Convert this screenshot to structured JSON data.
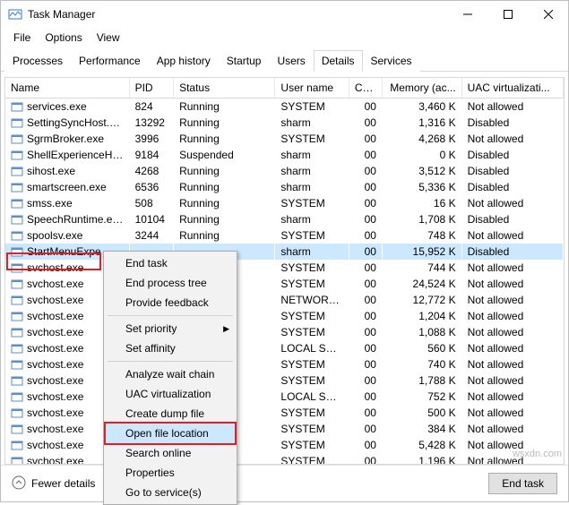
{
  "window": {
    "title": "Task Manager",
    "controls": {
      "min": "minimize",
      "max": "maximize",
      "close": "close"
    }
  },
  "menu": {
    "file": "File",
    "options": "Options",
    "view": "View"
  },
  "tabs": [
    {
      "label": "Processes"
    },
    {
      "label": "Performance"
    },
    {
      "label": "App history"
    },
    {
      "label": "Startup"
    },
    {
      "label": "Users"
    },
    {
      "label": "Details",
      "active": true
    },
    {
      "label": "Services"
    }
  ],
  "columns": {
    "name": "Name",
    "pid": "PID",
    "status": "Status",
    "user": "User name",
    "cpu": "CPU",
    "memory": "Memory (ac...",
    "uac": "UAC virtualizati..."
  },
  "rows": [
    {
      "name": "services.exe",
      "pid": "824",
      "status": "Running",
      "user": "SYSTEM",
      "cpu": "00",
      "mem": "3,460 K",
      "uac": "Not allowed"
    },
    {
      "name": "SettingSyncHost.exe",
      "pid": "13292",
      "status": "Running",
      "user": "sharm",
      "cpu": "00",
      "mem": "1,316 K",
      "uac": "Disabled"
    },
    {
      "name": "SgrmBroker.exe",
      "pid": "3996",
      "status": "Running",
      "user": "SYSTEM",
      "cpu": "00",
      "mem": "4,268 K",
      "uac": "Not allowed"
    },
    {
      "name": "ShellExperienceHost....",
      "pid": "9184",
      "status": "Suspended",
      "user": "sharm",
      "cpu": "00",
      "mem": "0 K",
      "uac": "Disabled"
    },
    {
      "name": "sihost.exe",
      "pid": "4268",
      "status": "Running",
      "user": "sharm",
      "cpu": "00",
      "mem": "3,512 K",
      "uac": "Disabled"
    },
    {
      "name": "smartscreen.exe",
      "pid": "6536",
      "status": "Running",
      "user": "sharm",
      "cpu": "00",
      "mem": "5,336 K",
      "uac": "Disabled"
    },
    {
      "name": "smss.exe",
      "pid": "508",
      "status": "Running",
      "user": "SYSTEM",
      "cpu": "00",
      "mem": "16 K",
      "uac": "Not allowed"
    },
    {
      "name": "SpeechRuntime.exe",
      "pid": "10104",
      "status": "Running",
      "user": "sharm",
      "cpu": "00",
      "mem": "1,708 K",
      "uac": "Disabled"
    },
    {
      "name": "spoolsv.exe",
      "pid": "3244",
      "status": "Running",
      "user": "SYSTEM",
      "cpu": "00",
      "mem": "748 K",
      "uac": "Not allowed"
    },
    {
      "name": "StartMenuExpe",
      "pid": "",
      "status": "",
      "user": "sharm",
      "cpu": "00",
      "mem": "15,952 K",
      "uac": "Disabled",
      "selected": true
    },
    {
      "name": "svchost.exe",
      "pid": "",
      "status": "",
      "user": "SYSTEM",
      "cpu": "00",
      "mem": "744 K",
      "uac": "Not allowed"
    },
    {
      "name": "svchost.exe",
      "pid": "",
      "status": "",
      "user": "SYSTEM",
      "cpu": "00",
      "mem": "24,524 K",
      "uac": "Not allowed"
    },
    {
      "name": "svchost.exe",
      "pid": "",
      "status": "",
      "user": "NETWORK ...",
      "cpu": "00",
      "mem": "12,772 K",
      "uac": "Not allowed"
    },
    {
      "name": "svchost.exe",
      "pid": "",
      "status": "",
      "user": "SYSTEM",
      "cpu": "00",
      "mem": "1,204 K",
      "uac": "Not allowed"
    },
    {
      "name": "svchost.exe",
      "pid": "",
      "status": "",
      "user": "SYSTEM",
      "cpu": "00",
      "mem": "1,088 K",
      "uac": "Not allowed"
    },
    {
      "name": "svchost.exe",
      "pid": "",
      "status": "",
      "user": "LOCAL SER...",
      "cpu": "00",
      "mem": "560 K",
      "uac": "Not allowed"
    },
    {
      "name": "svchost.exe",
      "pid": "",
      "status": "",
      "user": "SYSTEM",
      "cpu": "00",
      "mem": "740 K",
      "uac": "Not allowed"
    },
    {
      "name": "svchost.exe",
      "pid": "",
      "status": "",
      "user": "SYSTEM",
      "cpu": "00",
      "mem": "1,788 K",
      "uac": "Not allowed"
    },
    {
      "name": "svchost.exe",
      "pid": "",
      "status": "",
      "user": "LOCAL SER...",
      "cpu": "00",
      "mem": "752 K",
      "uac": "Not allowed"
    },
    {
      "name": "svchost.exe",
      "pid": "",
      "status": "",
      "user": "SYSTEM",
      "cpu": "00",
      "mem": "500 K",
      "uac": "Not allowed"
    },
    {
      "name": "svchost.exe",
      "pid": "",
      "status": "",
      "user": "SYSTEM",
      "cpu": "00",
      "mem": "384 K",
      "uac": "Not allowed"
    },
    {
      "name": "svchost.exe",
      "pid": "",
      "status": "",
      "user": "SYSTEM",
      "cpu": "00",
      "mem": "5,428 K",
      "uac": "Not allowed"
    },
    {
      "name": "svchost.exe",
      "pid": "",
      "status": "",
      "user": "SYSTEM",
      "cpu": "00",
      "mem": "1,196 K",
      "uac": "Not allowed"
    }
  ],
  "context_menu": {
    "end_task": "End task",
    "end_tree": "End process tree",
    "feedback": "Provide feedback",
    "priority": "Set priority",
    "affinity": "Set affinity",
    "analyze": "Analyze wait chain",
    "uac": "UAC virtualization",
    "dump": "Create dump file",
    "open_loc": "Open file location",
    "search": "Search online",
    "properties": "Properties",
    "services": "Go to service(s)"
  },
  "footer": {
    "fewer": "Fewer details",
    "end_task": "End task"
  },
  "watermark": "wsxdn.com"
}
